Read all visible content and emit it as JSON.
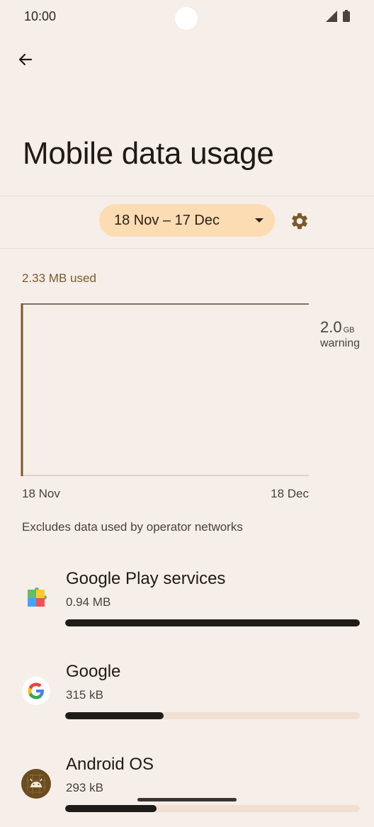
{
  "status_bar": {
    "time": "10:00"
  },
  "page": {
    "title": "Mobile data usage"
  },
  "cycle": {
    "selected": "18 Nov – 17 Dec"
  },
  "usage": {
    "total": "2.33 MB used"
  },
  "chart": {
    "warning_value": "2.0",
    "warning_unit": "GB",
    "warning_label": "warning",
    "start_date": "18 Nov",
    "end_date": "18 Dec"
  },
  "footnote": "Excludes data used by operator networks",
  "apps": [
    {
      "name": "Google Play services",
      "usage": "0.94 MB",
      "fraction": 1.0,
      "icon": "google-play-services-icon"
    },
    {
      "name": "Google",
      "usage": "315 kB",
      "fraction": 0.335,
      "icon": "google-icon"
    },
    {
      "name": "Android OS",
      "usage": "293 kB",
      "fraction": 0.31,
      "icon": "android-os-icon"
    }
  ],
  "colors": {
    "accent": "#7a5a2a",
    "chip": "#fcdcb3",
    "background": "#f6eee9"
  }
}
